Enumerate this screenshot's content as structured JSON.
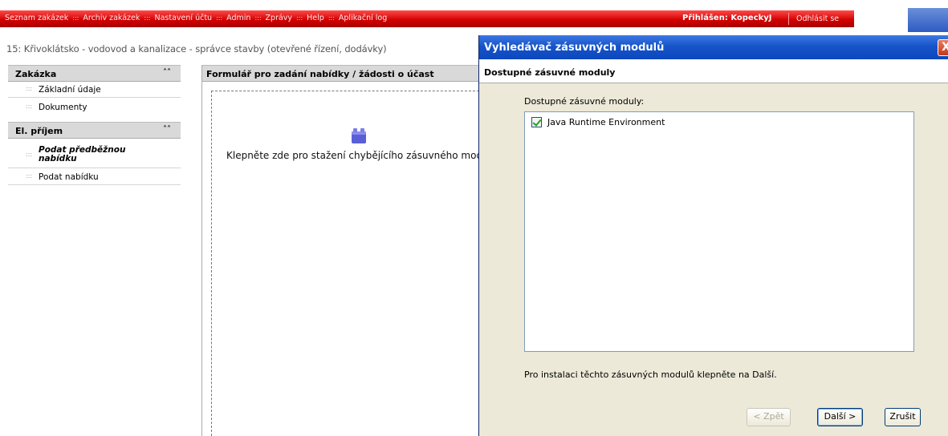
{
  "topnav": {
    "items": [
      "Seznam zakázek",
      "Archiv zakázek",
      "Nastavení účtu",
      "Admin",
      "Zprávy",
      "Help",
      "Aplikační log"
    ],
    "separator": ":::",
    "login": "Přihlášen: KopeckyJ",
    "logout": "Odhlásit se",
    "color": "#d00000"
  },
  "breadcrumb": "15: Křivoklátsko - vodovod a kanalizace - správce stavby (otevřené řízení, dodávky)",
  "sidebar": {
    "sections": [
      {
        "title": "Zakázka",
        "items": [
          "Základní údaje",
          "Dokumenty"
        ]
      },
      {
        "title": "El. příjem",
        "items": [
          "Podat předběžnou nabídku",
          "Podat nabídku"
        ]
      }
    ],
    "chevron": "≈"
  },
  "form": {
    "title": "Formulář pro zadání nabídky / žádosti o účast",
    "plugin_text": "Klepněte zde pro stažení chybějícího zásuvného modulu."
  },
  "dialog": {
    "title": "Vyhledávač zásuvných modulů",
    "close": "X",
    "subtitle": "Dostupné zásuvné moduly",
    "list_label": "Dostupné zásuvné moduly:",
    "modules": [
      {
        "name": "Java Runtime Environment",
        "checked": true
      }
    ],
    "hint": "Pro instalaci těchto zásuvných modulů klepněte na Další.",
    "buttons": {
      "back": "< Zpět",
      "next": "Další >",
      "cancel": "Zrušit"
    }
  }
}
